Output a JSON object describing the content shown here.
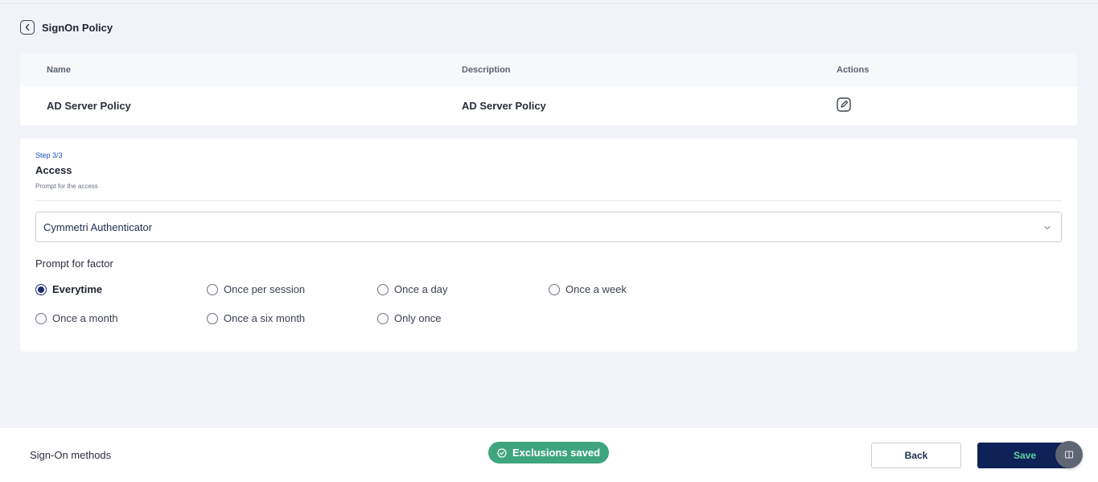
{
  "header": {
    "title": "SignOn Policy"
  },
  "table": {
    "columns": {
      "name": "Name",
      "description": "Description",
      "actions": "Actions"
    },
    "rows": [
      {
        "name": "AD Server Policy",
        "description": "AD Server Policy"
      }
    ]
  },
  "step": {
    "label": "Step 3/3",
    "title": "Access",
    "subtitle": "Prompt for the access",
    "authenticator": {
      "selected": "Cymmetri Authenticator"
    },
    "prompt_label": "Prompt for factor",
    "options": [
      {
        "label": "Everytime",
        "checked": true
      },
      {
        "label": "Once per session",
        "checked": false
      },
      {
        "label": "Once a day",
        "checked": false
      },
      {
        "label": "Once a week",
        "checked": false
      },
      {
        "label": "Once a month",
        "checked": false
      },
      {
        "label": "Once a six month",
        "checked": false
      },
      {
        "label": "Only once",
        "checked": false
      }
    ]
  },
  "footer": {
    "title": "Sign-On methods",
    "toast": "Exclusions saved",
    "back_label": "Back",
    "save_label": "Save"
  },
  "colors": {
    "primary": "#0f2257",
    "accent_green": "#3fa57e",
    "step_blue": "#1b4fae"
  }
}
